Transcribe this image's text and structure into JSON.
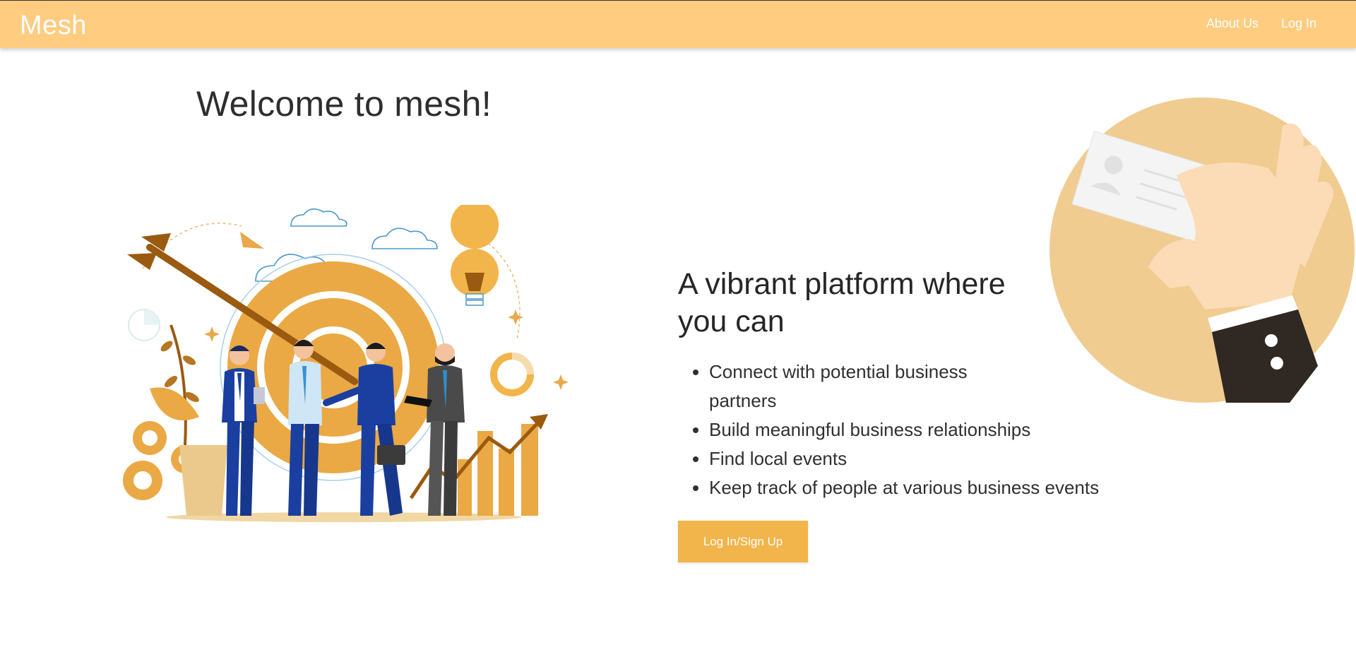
{
  "nav": {
    "brand": "Mesh",
    "links": [
      "About Us",
      "Log In"
    ]
  },
  "hero": {
    "welcome": "Welcome to mesh!"
  },
  "info": {
    "heading": "A vibrant platform where you can",
    "bullets": [
      "Connect with potential business partners",
      "Build meaningful business relationships",
      "Find local events",
      "Keep track of people at various business events"
    ],
    "cta_label": "Log In/Sign Up"
  },
  "colors": {
    "navbar": "#ffcc80",
    "accent": "#f2b54b",
    "card_circle": "#f0cc90",
    "text": "#2b2b2b"
  }
}
